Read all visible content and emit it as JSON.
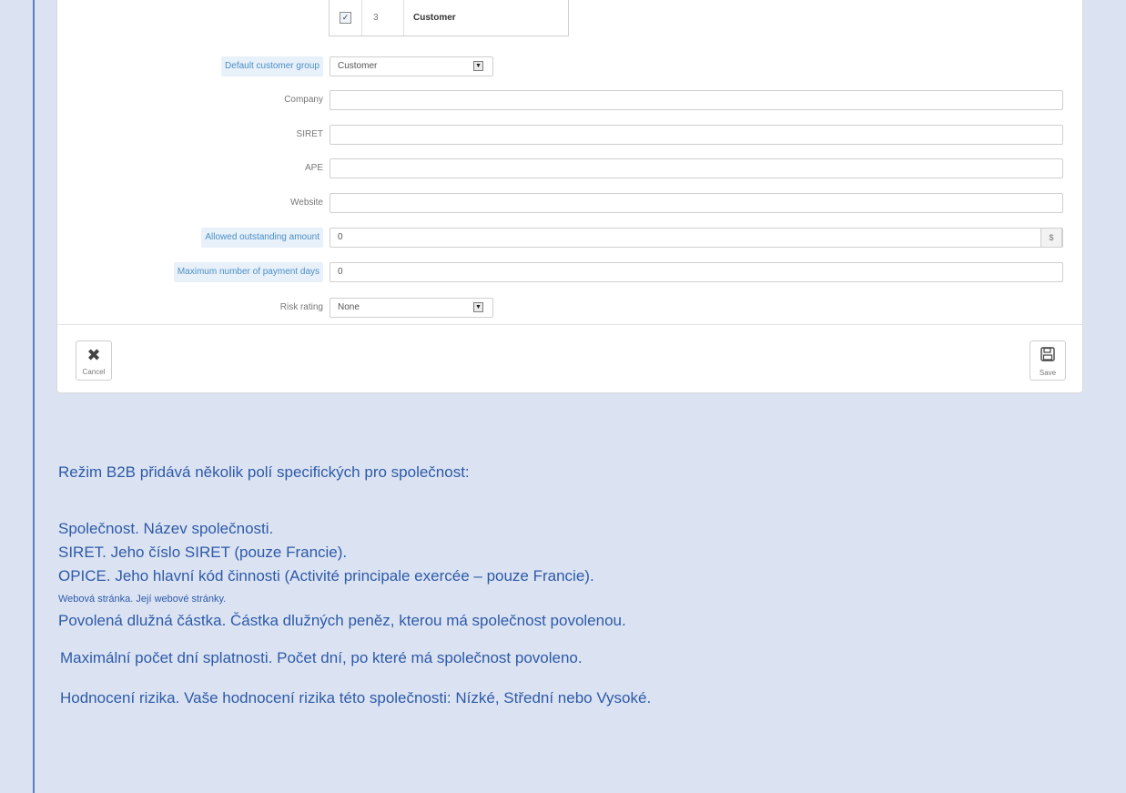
{
  "group_table": {
    "checked": true,
    "check_mark": "✓",
    "id": "3",
    "name": "Customer"
  },
  "form": {
    "default_group": {
      "label": "Default customer group",
      "value": "Customer"
    },
    "company": {
      "label": "Company",
      "value": ""
    },
    "siret": {
      "label": "SIRET",
      "value": ""
    },
    "ape": {
      "label": "APE",
      "value": ""
    },
    "website": {
      "label": "Website",
      "value": ""
    },
    "outstanding": {
      "label": "Allowed outstanding amount",
      "value": "0",
      "currency": "$"
    },
    "payment_days": {
      "label": "Maximum number of payment days",
      "value": "0"
    },
    "risk": {
      "label": "Risk rating",
      "value": "None"
    }
  },
  "buttons": {
    "cancel": "Cancel",
    "save": "Save"
  },
  "icons": {
    "cancel": "close-icon",
    "save": "floppy-disk-icon",
    "select": "chevron-down-icon"
  },
  "description": {
    "intro": "Režim B2B přidává několik polí specifických pro společnost:",
    "items": [
      "Společnost. Název společnosti.",
      "SIRET. Jeho číslo SIRET (pouze Francie).",
      "OPICE. Jeho hlavní kód činnosti (Activité principale exercée – pouze Francie).",
      "Webová stránka. Její webové stránky.",
      "Povolená dlužná částka. Částka dlužných peněz, kterou má společnost povolenou.",
      "Maximální počet dní splatnosti. Počet dní, po které má společnost povoleno.",
      "Hodnocení rizika. Vaše hodnocení rizika této společnosti: Nízké, Střední nebo Vysoké."
    ]
  },
  "colors": {
    "page_background": "#dbe3f3",
    "text_link_blue": "#2e5aa7",
    "hint_label": "#4b8fc9"
  }
}
